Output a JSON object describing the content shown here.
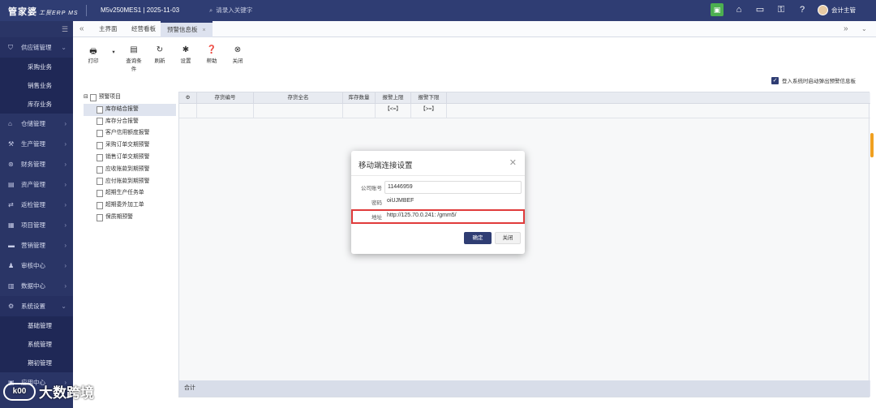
{
  "app": {
    "brand": "管家婆",
    "brand_sub": "工贸ERP MS",
    "account": "M5v250MES1",
    "date": "2025-11-03",
    "search_placeholder": "请录入关键字",
    "user": "会计主管"
  },
  "sidebar": {
    "items": [
      {
        "label": "供应链管理",
        "icon": "supply-chain-icon",
        "open": true,
        "subs": [
          "采购业务",
          "销售业务",
          "库存业务"
        ]
      },
      {
        "label": "仓储管理",
        "icon": "warehouse-icon"
      },
      {
        "label": "生产管理",
        "icon": "production-icon"
      },
      {
        "label": "财务管理",
        "icon": "finance-icon"
      },
      {
        "label": "资产管理",
        "icon": "asset-icon"
      },
      {
        "label": "返检管理",
        "icon": "return-icon"
      },
      {
        "label": "项目管理",
        "icon": "project-icon"
      },
      {
        "label": "营销管理",
        "icon": "marketing-icon"
      },
      {
        "label": "审核中心",
        "icon": "audit-icon"
      },
      {
        "label": "数据中心",
        "icon": "data-icon"
      },
      {
        "label": "系统设置",
        "icon": "settings-icon",
        "open": true,
        "subs": [
          "基础管理",
          "系统管理",
          "期初管理"
        ]
      },
      {
        "label": "应用中心",
        "icon": "app-icon"
      }
    ]
  },
  "tabs": [
    {
      "label": "主界面"
    },
    {
      "label": "经营看板"
    },
    {
      "label": "预警信息板",
      "active": true
    }
  ],
  "toolbar": [
    {
      "label": "打印",
      "icon": "printer-icon"
    },
    {
      "label": "查询条件",
      "icon": "filter-icon"
    },
    {
      "label": "刷新",
      "icon": "refresh-icon"
    },
    {
      "label": "设置",
      "icon": "gear-icon"
    },
    {
      "label": "帮助",
      "icon": "help-icon"
    },
    {
      "label": "关闭",
      "icon": "close-icon"
    }
  ],
  "auto_popup_label": "登入系统时启动弹出预警信息板",
  "tree": {
    "root": "预警项目",
    "children": [
      "库存结合报警",
      "库存分合报警",
      "客户信用额度报警",
      "采购订单交期预警",
      "销售订单交期预警",
      "应收账款到期预警",
      "应付账款到期预警",
      "超期生产任务单",
      "超期委外加工单",
      "保质期预警"
    ]
  },
  "grid": {
    "columns": [
      "存货编号",
      "存货全名",
      "库存数量",
      "报警上限【<=】",
      "报警下限【>=】"
    ],
    "footer_label": "合计"
  },
  "dialog": {
    "title": "移动端连接设置",
    "fields": [
      {
        "label": "公司账号",
        "value": "11446959"
      },
      {
        "label": "密码",
        "value": "oiUJMBEF"
      },
      {
        "label": "地址",
        "value": "http://125.70.0.241:     /gmm5/"
      }
    ],
    "ok_label": "确定",
    "cancel_label": "关闭"
  },
  "watermark": {
    "logo": "k00",
    "text": "大数跨境"
  }
}
